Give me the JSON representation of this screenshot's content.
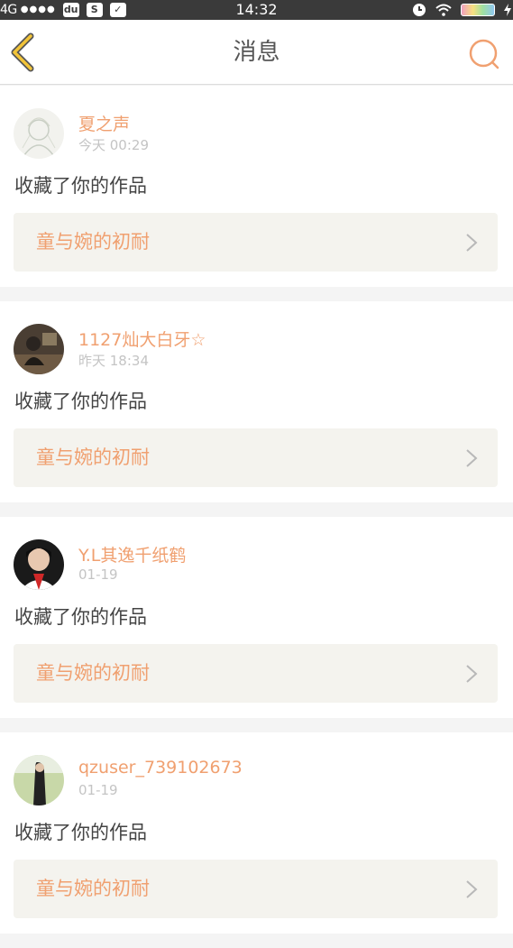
{
  "status_bar": {
    "carrier": "4G",
    "signal_dots": "●●●●",
    "app_icons": [
      "du",
      "S",
      "✓"
    ],
    "time": "14:32"
  },
  "header": {
    "title": "消息",
    "back_icon": "chevron-left-icon",
    "search_icon": "search-icon",
    "accent_color": "#f0a070"
  },
  "messages": [
    {
      "username": "夏之声",
      "time": "今天 00:29",
      "action": "收藏了你的作品",
      "work_title": "童与婉的初耐"
    },
    {
      "username": "1127灿大白牙☆",
      "time": "昨天 18:34",
      "action": "收藏了你的作品",
      "work_title": "童与婉的初耐"
    },
    {
      "username": "Y.L其逸千纸鹤",
      "time": "01-19",
      "action": "收藏了你的作品",
      "work_title": "童与婉的初耐"
    },
    {
      "username": "qzuser_739102673",
      "time": "01-19",
      "action": "收藏了你的作品",
      "work_title": "童与婉的初耐"
    }
  ]
}
